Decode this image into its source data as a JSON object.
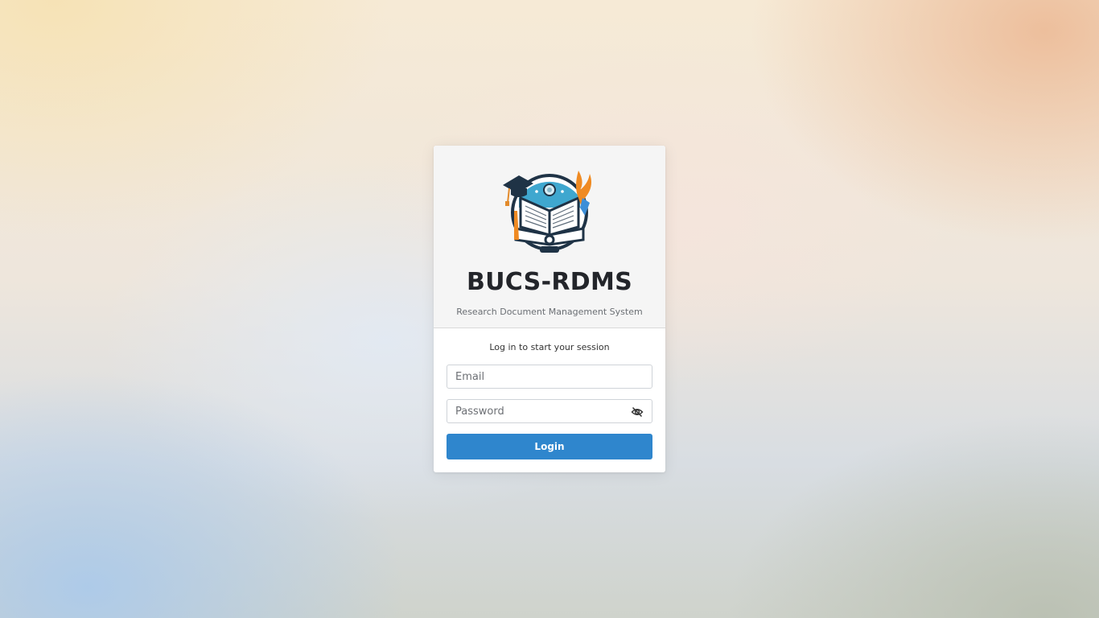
{
  "brand": {
    "title": "BUCS-RDMS",
    "subtitle": "Research Document Management System",
    "logo_icon": "book-graduation-logo"
  },
  "login": {
    "message": "Log in to start your session",
    "email_placeholder": "Email",
    "email_value": "",
    "password_placeholder": "Password",
    "password_value": "",
    "toggle_icon": "eye-slash-icon",
    "button_label": "Login"
  },
  "colors": {
    "primary": "#2f86cd",
    "heading": "#23252a",
    "header_bg": "#f5f5f5"
  }
}
